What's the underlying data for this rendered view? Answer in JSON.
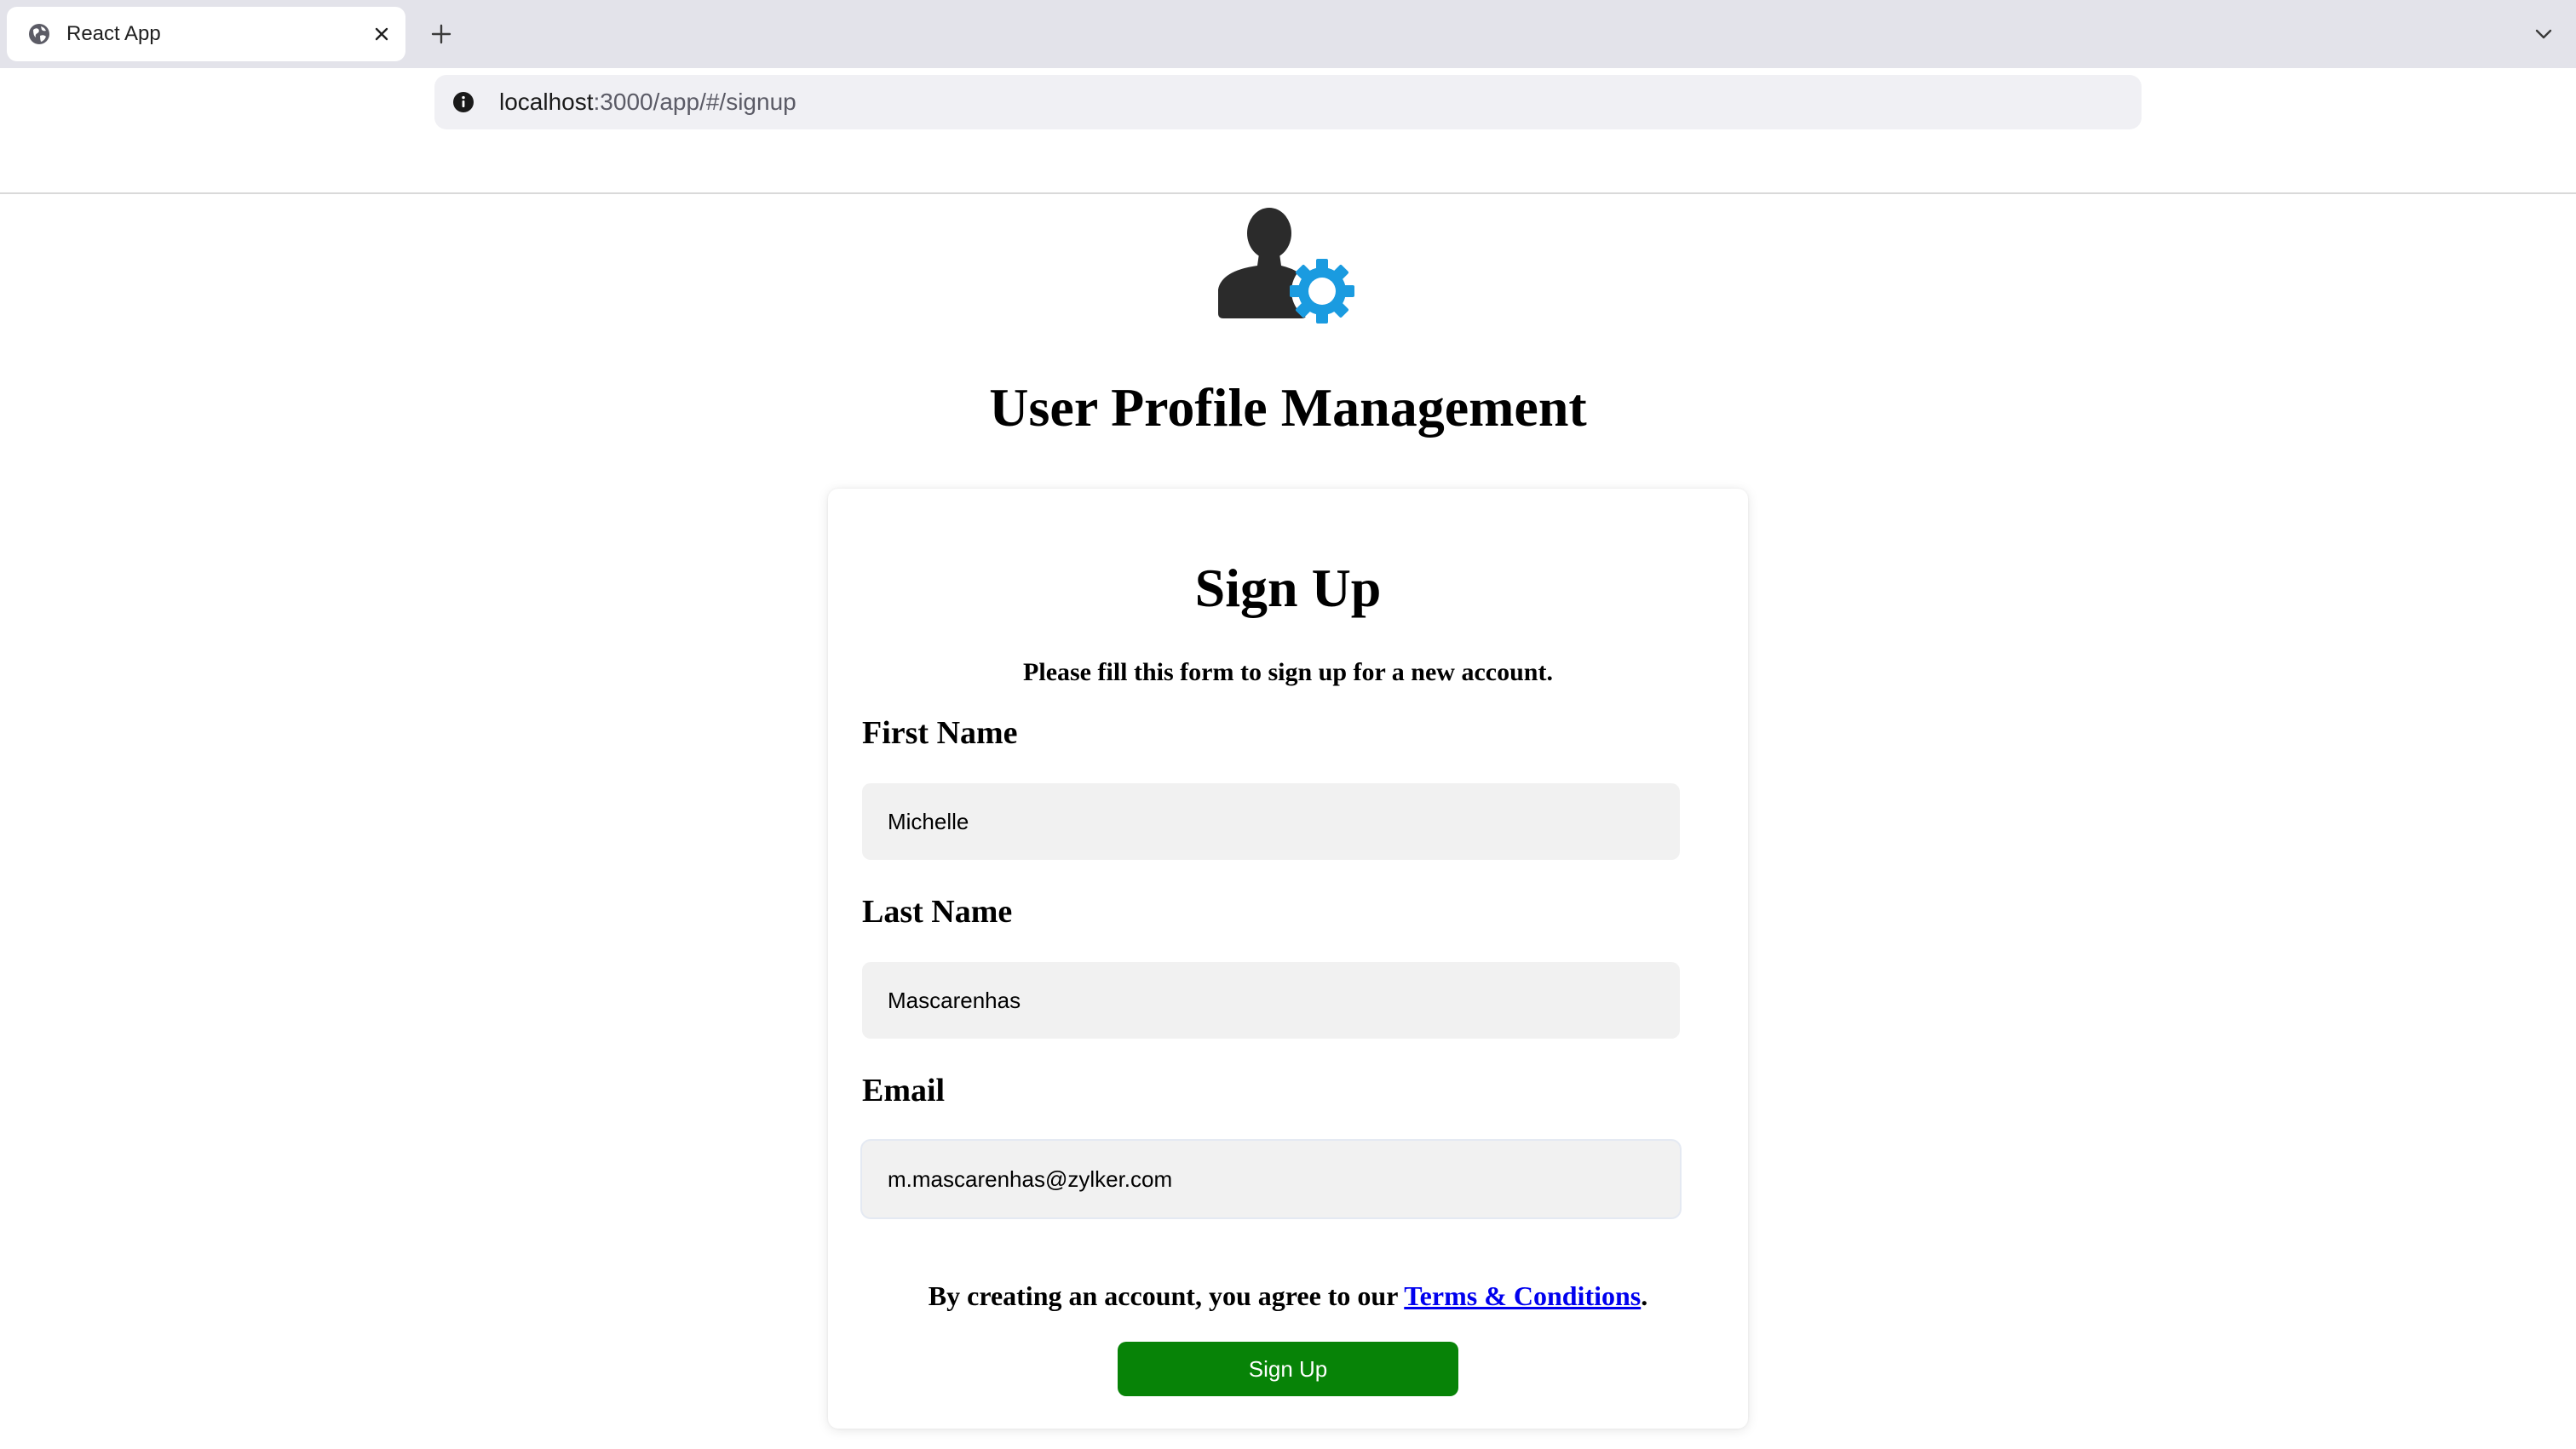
{
  "browser": {
    "tab_title": "React App",
    "url_host": "localhost",
    "url_path": ":3000/app/#/signup"
  },
  "page": {
    "title": "User Profile Management"
  },
  "form": {
    "title": "Sign Up",
    "subtitle": "Please fill this form to sign up for a new account.",
    "first_name": {
      "label": "First Name",
      "value": "Michelle"
    },
    "last_name": {
      "label": "Last Name",
      "value": "Mascarenhas"
    },
    "email": {
      "label": "Email",
      "value": "m.mascarenhas@zylker.com"
    },
    "terms_prefix": "By creating an account, you agree to our ",
    "terms_link": "Terms & Conditions",
    "terms_suffix": ".",
    "submit_label": "Sign Up"
  },
  "icons": {
    "tab_icon": "globe-icon",
    "close": "close-icon",
    "new_tab": "plus-icon",
    "tab_list": "chevron-down-icon",
    "site_info": "info-icon",
    "logo": "user-gear-icon"
  },
  "colors": {
    "accent_blue": "#1a9be0",
    "logo_dark": "#2b2b2b",
    "button_green": "#078307",
    "link_blue": "#0000ee"
  }
}
